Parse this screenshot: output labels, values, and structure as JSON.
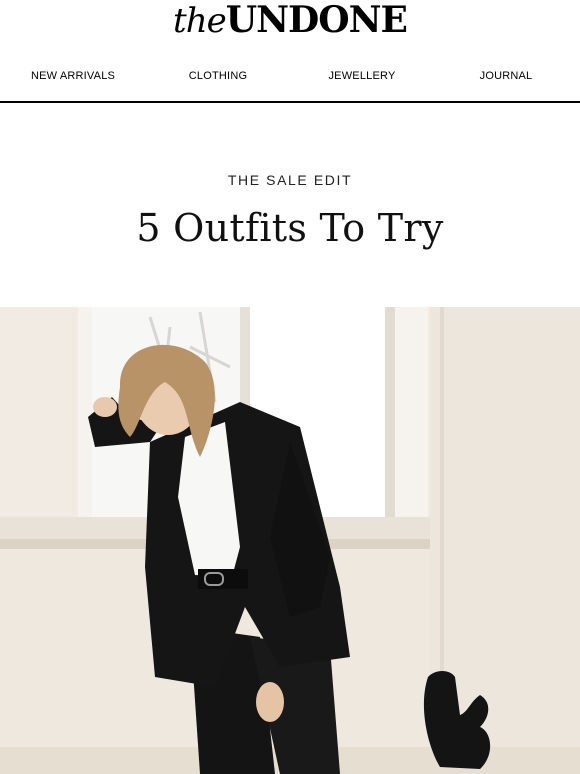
{
  "header": {
    "logo_prefix": "the",
    "logo_brand": "UNDONE"
  },
  "nav": {
    "items": [
      {
        "label": "NEW ARRIVALS"
      },
      {
        "label": "CLOTHING"
      },
      {
        "label": "JEWELLERY"
      },
      {
        "label": "JOURNAL"
      }
    ]
  },
  "hero_section": {
    "eyebrow": "THE SALE EDIT",
    "title": "5 Outfits To Try"
  },
  "colors": {
    "text": "#111111",
    "divider": "#000000",
    "wall": "#f3ede6",
    "suit": "#141414"
  }
}
